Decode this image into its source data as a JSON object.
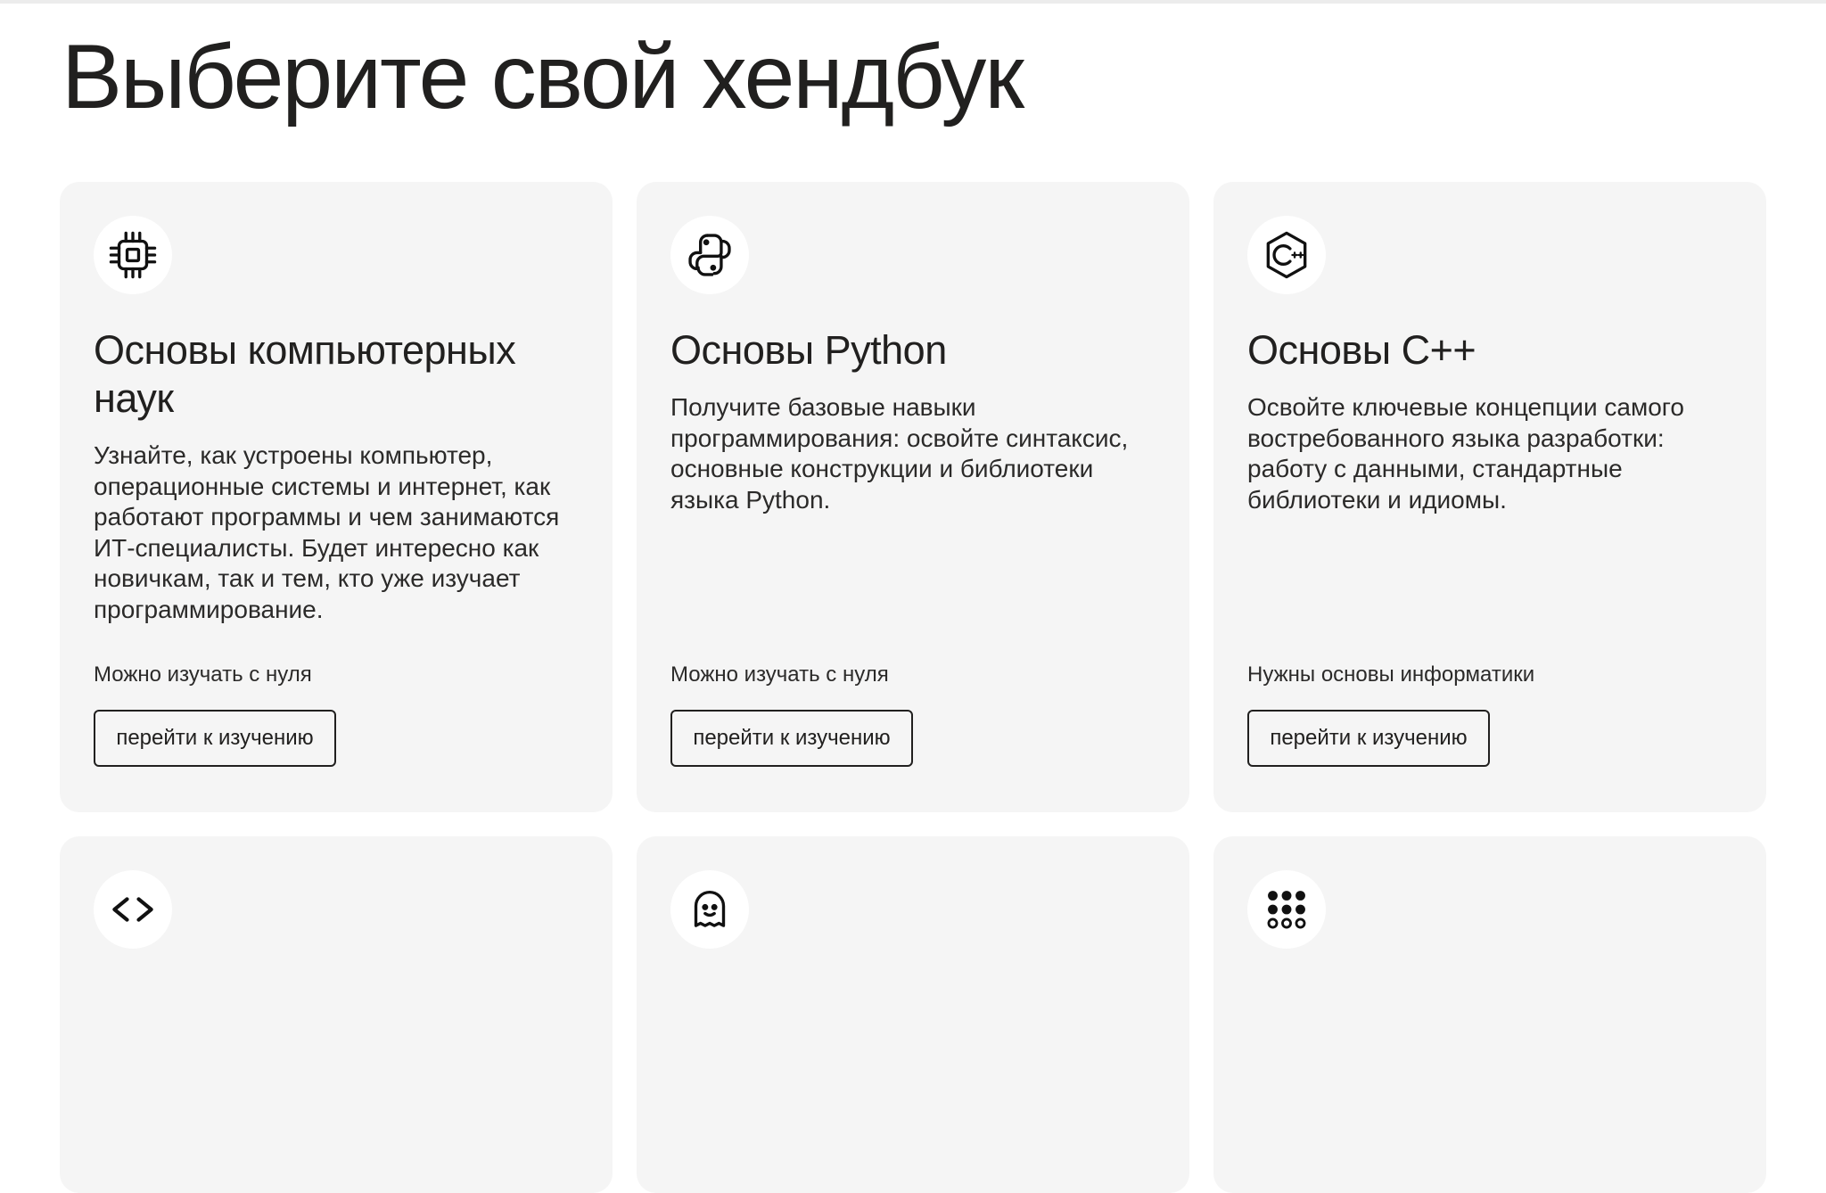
{
  "page": {
    "title": "Выберите свой хендбук"
  },
  "cards": [
    {
      "icon": "cpu-chip-icon",
      "title": "Основы компьютерных наук",
      "description": "Узнайте, как устроены компьютер, операционные системы и интернет, как работают программы и чем занимаются ИТ-специалисты. Будет интересно как новичкам, так и тем, кто уже изучает программирование.",
      "requirement": "Можно изучать с нуля",
      "button_label": "перейти к изучению"
    },
    {
      "icon": "python-logo-icon",
      "title": "Основы Python",
      "description": "Получите базовые навыки программирования: освойте синтаксис, основные конструкции и библиотеки языка Python.",
      "requirement": "Можно изучать с нуля",
      "button_label": "перейти к изучению"
    },
    {
      "icon": "cpp-logo-icon",
      "title": "Основы C++",
      "description": "Освойте ключевые концепции самого востребованного языка разработки: работу с данными, стандартные библиотеки и идиомы.",
      "requirement": "Нужны основы информатики",
      "button_label": "перейти к изучению"
    },
    {
      "icon": "code-brackets-icon"
    },
    {
      "icon": "ghost-icon"
    },
    {
      "icon": "dots-grid-icon"
    }
  ]
}
